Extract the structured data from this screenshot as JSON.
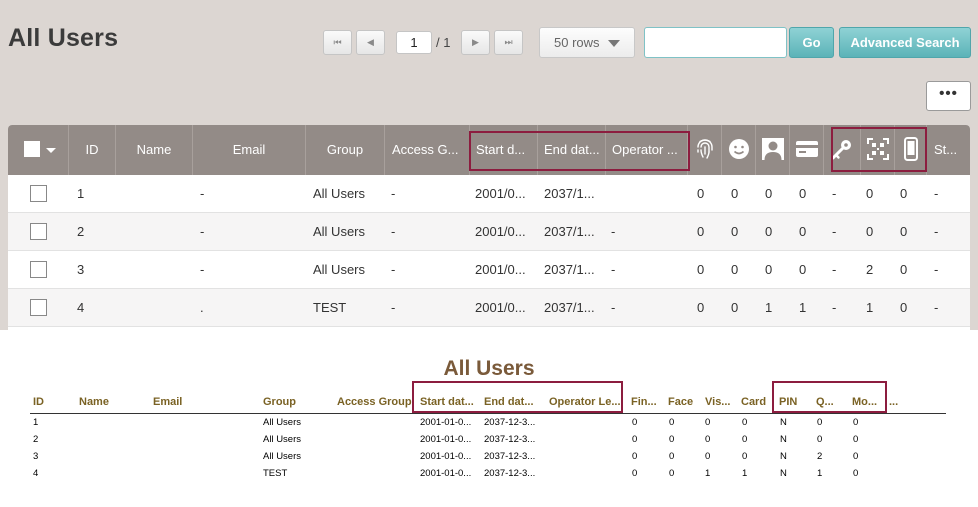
{
  "page": {
    "title": "All Users",
    "pagination": {
      "current": "1",
      "total": "/ 1",
      "first_icon": "⏮",
      "prev_icon": "◀",
      "next_icon": "▶",
      "last_icon": "⏭"
    },
    "rows_per_page": "50 rows",
    "search_value": "",
    "go_label": "Go",
    "advanced_search_label": "Advanced Search",
    "more_label": "•••"
  },
  "grid": {
    "headers": [
      "ID",
      "Name",
      "Email",
      "Group",
      "Access G...",
      "Start d...",
      "End dat...",
      "Operator ...",
      "St..."
    ],
    "icon_columns": [
      "fingerprint-icon",
      "face-icon",
      "visual-face-icon",
      "card-icon",
      "pin-key-icon",
      "qr-code-icon",
      "mobile-icon"
    ],
    "rows": [
      {
        "id": "1",
        "name": "",
        "email": "-",
        "group": "All Users",
        "access": "-",
        "start": "2001/0...",
        "end": "2037/1...",
        "operator": "",
        "fp": "0",
        "face": "0",
        "visual": "0",
        "card": "0",
        "pin": "-",
        "qr": "0",
        "mobile": "0",
        "status": "-"
      },
      {
        "id": "2",
        "name": "",
        "email": "-",
        "group": "All Users",
        "access": "-",
        "start": "2001/0...",
        "end": "2037/1...",
        "operator": "-",
        "fp": "0",
        "face": "0",
        "visual": "0",
        "card": "0",
        "pin": "-",
        "qr": "0",
        "mobile": "0",
        "status": "-"
      },
      {
        "id": "3",
        "name": "",
        "email": "-",
        "group": "All Users",
        "access": "-",
        "start": "2001/0...",
        "end": "2037/1...",
        "operator": "-",
        "fp": "0",
        "face": "0",
        "visual": "0",
        "card": "0",
        "pin": "-",
        "qr": "2",
        "mobile": "0",
        "status": "-"
      },
      {
        "id": "4",
        "name": "",
        "email": ".",
        "group": "TEST",
        "access": "-",
        "start": "2001/0...",
        "end": "2037/1...",
        "operator": "-",
        "fp": "0",
        "face": "0",
        "visual": "1",
        "card": "1",
        "pin": "-",
        "qr": "1",
        "mobile": "0",
        "status": "-"
      }
    ]
  },
  "report": {
    "title": "All Users",
    "headers": [
      "ID",
      "Name",
      "Email",
      "Group",
      "Access Group",
      "Start dat...",
      "End dat...",
      "Operator Le...",
      "Fin...",
      "Face",
      "Vis...",
      "Card",
      "PIN",
      "Q...",
      "Mo...",
      "..."
    ],
    "rows": [
      {
        "id": "1",
        "group": "All Users",
        "start": "2001-01-0...",
        "end": "2037-12-3...",
        "fin": "0",
        "face": "0",
        "vis": "0",
        "card": "0",
        "pin": "N",
        "q": "0",
        "mo": "0"
      },
      {
        "id": "2",
        "group": "All Users",
        "start": "2001-01-0...",
        "end": "2037-12-3...",
        "fin": "0",
        "face": "0",
        "vis": "0",
        "card": "0",
        "pin": "N",
        "q": "0",
        "mo": "0"
      },
      {
        "id": "3",
        "group": "All Users",
        "start": "2001-01-0...",
        "end": "2037-12-3...",
        "fin": "0",
        "face": "0",
        "vis": "0",
        "card": "0",
        "pin": "N",
        "q": "2",
        "mo": "0"
      },
      {
        "id": "4",
        "group": "TEST",
        "start": "2001-01-0...",
        "end": "2037-12-3...",
        "fin": "0",
        "face": "0",
        "vis": "1",
        "card": "1",
        "pin": "N",
        "q": "1",
        "mo": "0"
      }
    ]
  },
  "colors": {
    "highlight": "#8c1d3f",
    "accent": "#5bb3b8",
    "header_bg": "#938b87",
    "panel_bg": "#dcd6d2",
    "report_header": "#7a6224"
  }
}
